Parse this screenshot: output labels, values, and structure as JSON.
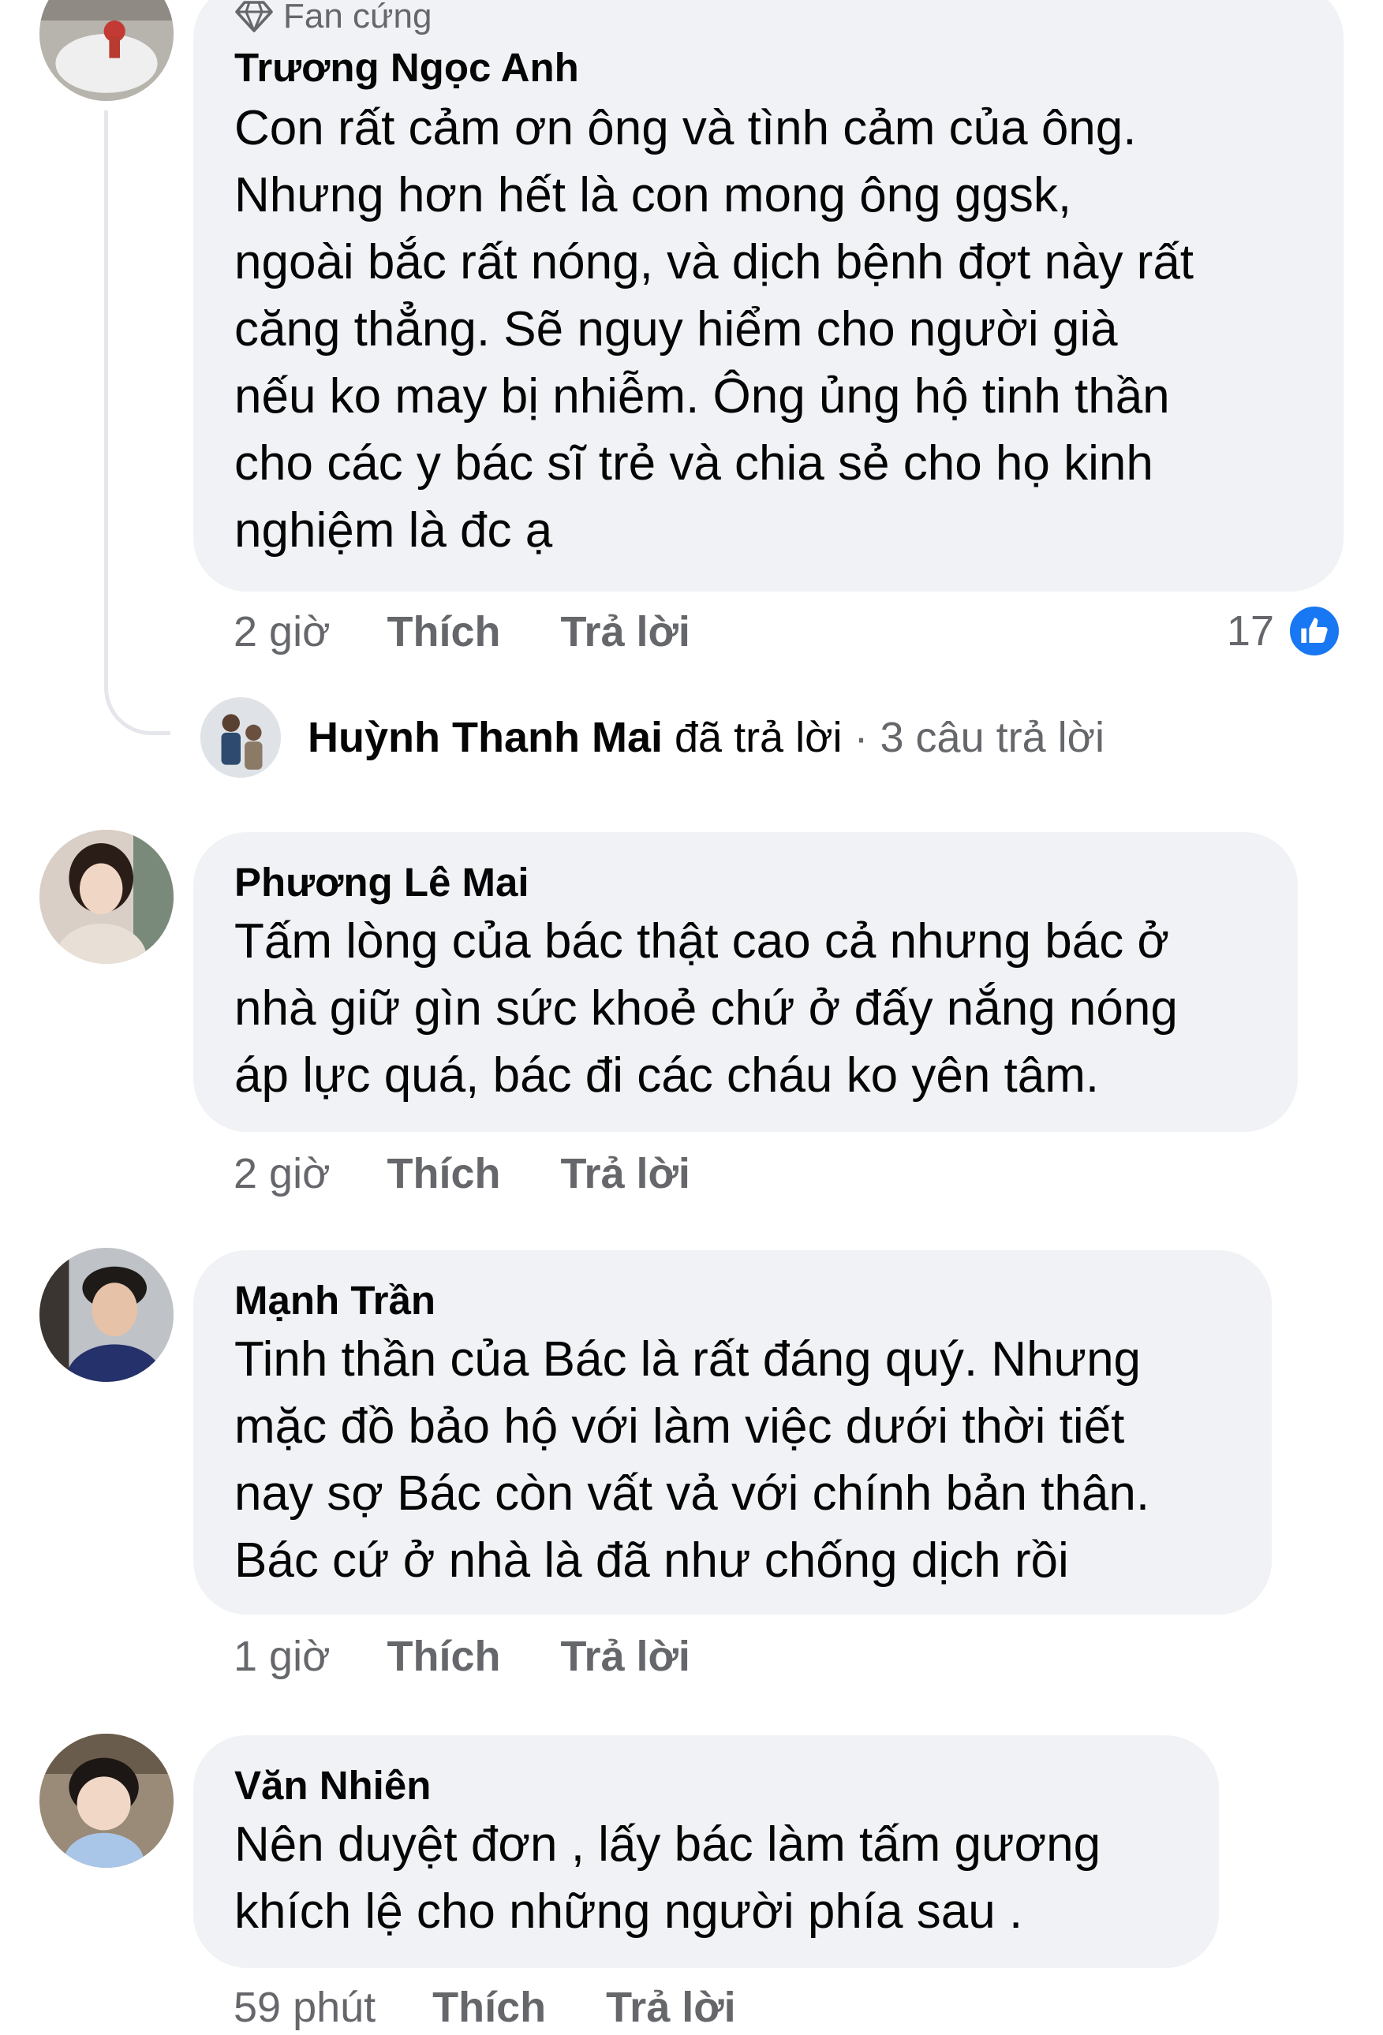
{
  "comments": [
    {
      "badge": "Fan cứng",
      "author": "Trương Ngọc Anh",
      "text": "Con rất cảm ơn ông và tình cảm của ông.\nNhưng hơn hết là con mong ông ggsk,\nngoài bắc rất nóng, và dịch bệnh đợt này rất\ncăng thẳng. Sẽ nguy hiểm cho người già\nnếu ko may bị nhiễm. Ông ủng hộ tinh thần\ncho các y bác sĩ trẻ và chia sẻ cho họ kinh\nnghiệm là đc ạ",
      "time": "2 giờ",
      "like_label": "Thích",
      "reply_label": "Trả lời",
      "reaction_count": "17",
      "reaction_icon": "like-icon",
      "replies_summary": {
        "name": "Huỳnh Thanh Mai",
        "action": "đã trả lời",
        "separator": "·",
        "count_text": "3 câu trả lời"
      }
    },
    {
      "author": "Phương Lê Mai",
      "text": "Tấm lòng của bác thật cao cả nhưng bác ở\nnhà giữ gìn sức khoẻ chứ ở đấy nắng nóng\náp lực quá, bác đi các cháu ko yên tâm.",
      "time": "2 giờ",
      "like_label": "Thích",
      "reply_label": "Trả lời"
    },
    {
      "author": "Mạnh Trần",
      "text": "Tinh thần của Bác là rất đáng quý. Nhưng\nmặc đồ bảo hộ với làm việc dưới thời tiết\nnay sợ Bác còn vất vả với chính bản thân.\nBác cứ ở nhà là đã như chống dịch rồi",
      "time": "1 giờ",
      "like_label": "Thích",
      "reply_label": "Trả lời"
    },
    {
      "author": "Văn Nhiên",
      "text": "Nên duyệt đơn , lấy bác làm tấm gương\nkhích lệ cho những người phía sau .",
      "time": "59 phút",
      "like_label": "Thích",
      "reply_label": "Trả lời"
    }
  ],
  "colors": {
    "bubble": "#f0f2f5",
    "muted": "#65676b",
    "text": "#050505",
    "like_blue": "#1877f2",
    "thread_line": "#e4e6eb"
  }
}
